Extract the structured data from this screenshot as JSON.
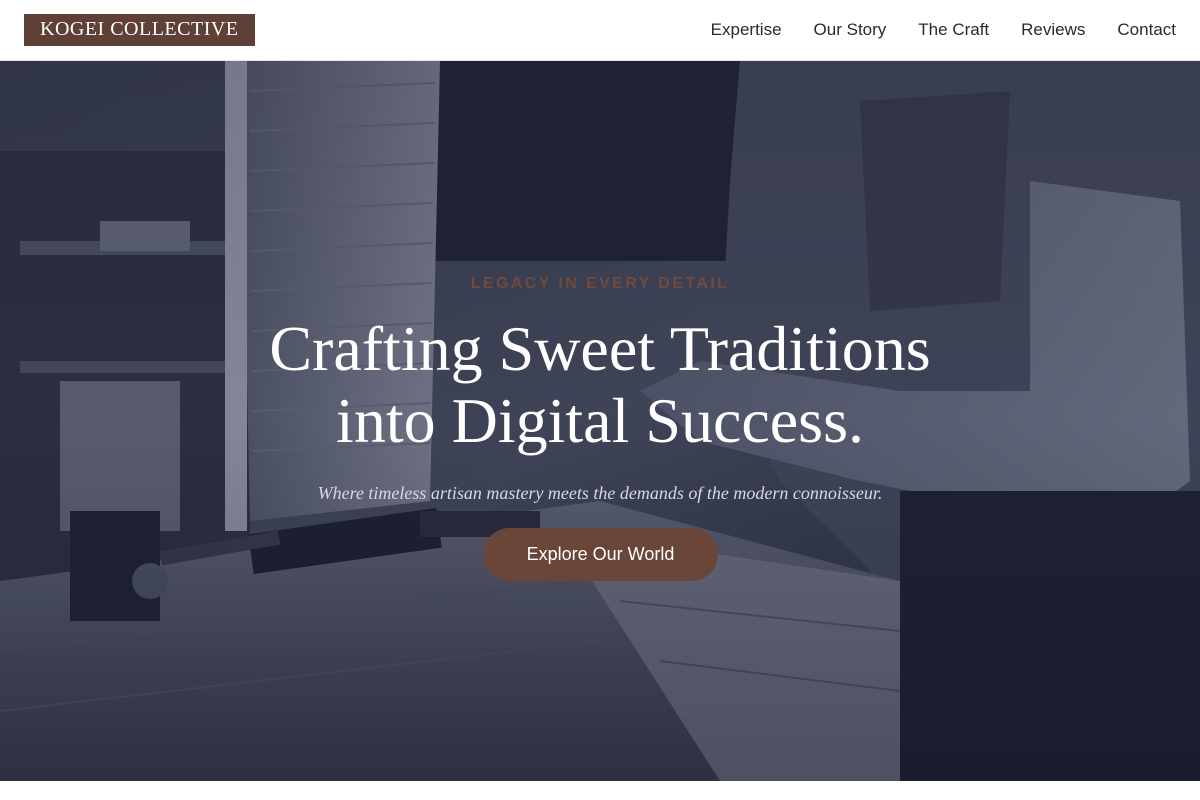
{
  "header": {
    "logo_text": "KOGEI COLLECTIVE",
    "nav": [
      {
        "label": "Expertise"
      },
      {
        "label": "Our Story"
      },
      {
        "label": "The Craft"
      },
      {
        "label": "Reviews"
      },
      {
        "label": "Contact"
      }
    ]
  },
  "hero": {
    "eyebrow": "LEGACY IN EVERY DETAIL",
    "headline_line1": "Crafting Sweet Traditions",
    "headline_line2": "into Digital Success.",
    "subtitle": "Where timeless artisan mastery meets the demands of the modern connoisseur.",
    "cta_label": "Explore Our World"
  },
  "colors": {
    "brand": "#5e4036",
    "cta": "#6a4638",
    "eyebrow": "#6e4b3d",
    "hero_tint": "#2b3040"
  }
}
